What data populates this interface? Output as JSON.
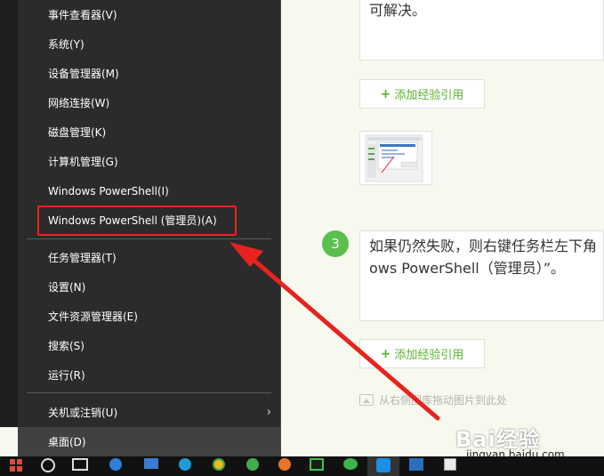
{
  "menu": {
    "items": [
      {
        "label": "事件查看器(V)",
        "name": "menu-item-event-viewer"
      },
      {
        "label": "系统(Y)",
        "name": "menu-item-system"
      },
      {
        "label": "设备管理器(M)",
        "name": "menu-item-device-manager"
      },
      {
        "label": "网络连接(W)",
        "name": "menu-item-network-connections"
      },
      {
        "label": "磁盘管理(K)",
        "name": "menu-item-disk-management"
      },
      {
        "label": "计算机管理(G)",
        "name": "menu-item-computer-management"
      },
      {
        "label": "Windows PowerShell(I)",
        "name": "menu-item-powershell"
      },
      {
        "label": "Windows PowerShell (管理员)(A)",
        "name": "menu-item-powershell-admin"
      },
      {
        "label": "任务管理器(T)",
        "name": "menu-item-task-manager"
      },
      {
        "label": "设置(N)",
        "name": "menu-item-settings"
      },
      {
        "label": "文件资源管理器(E)",
        "name": "menu-item-file-explorer"
      },
      {
        "label": "搜索(S)",
        "name": "menu-item-search"
      },
      {
        "label": "运行(R)",
        "name": "menu-item-run"
      },
      {
        "label": "关机或注销(U)",
        "name": "menu-item-shutdown"
      },
      {
        "label": "桌面(D)",
        "name": "menu-item-desktop"
      }
    ],
    "submenu_arrow": "›"
  },
  "article": {
    "top_text": "可解决。",
    "add_ref_plus": "+",
    "add_ref_label": "添加经验引用",
    "step_number": "3",
    "step_text_line1": "如果仍然失败，则右键任务栏左下角",
    "step_text_line2": "ows PowerShell（管理员）”。",
    "drag_hint": "从右侧图库拖动图片到此处"
  },
  "watermark": {
    "brand": "Bai经验",
    "url": "jingyan.baidu.com"
  },
  "colors": {
    "menu_bg": "#2b2b2b",
    "highlight": "#e8231f",
    "accent_green": "#5cb030"
  },
  "icons": {
    "start": "windows-start-icon",
    "cortana": "cortana-circle-icon",
    "arrow": "red-pointer-arrow"
  }
}
